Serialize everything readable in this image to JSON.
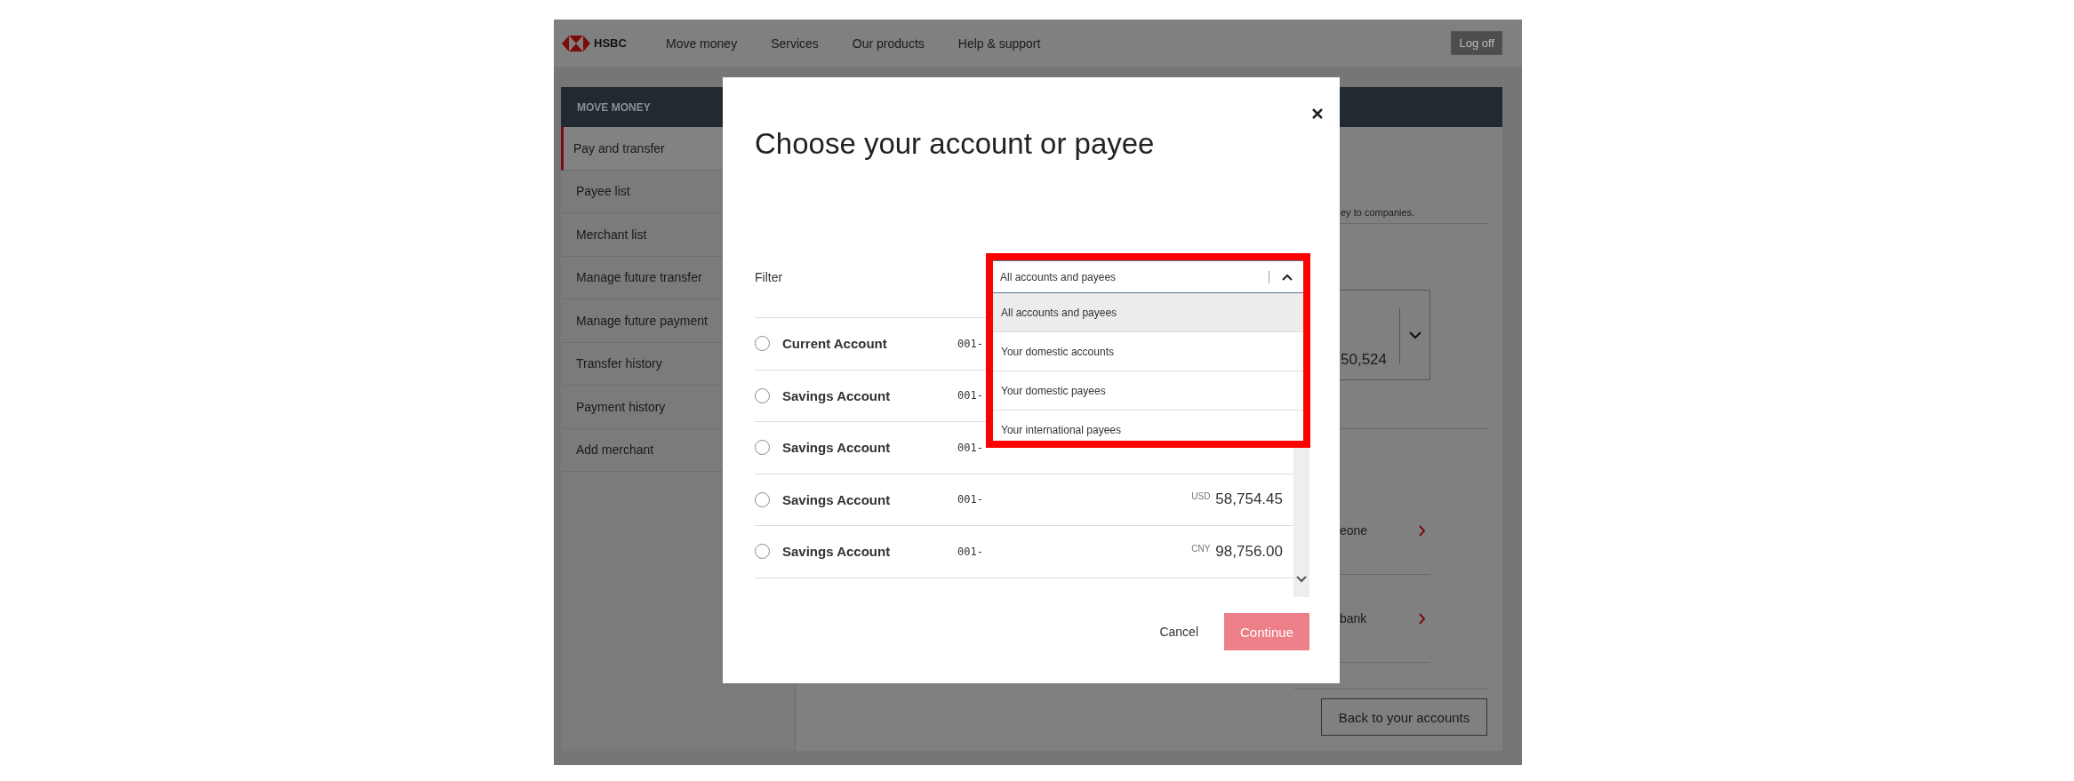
{
  "header": {
    "brand": "HSBC",
    "nav": [
      {
        "label": "Move money"
      },
      {
        "label": "Services"
      },
      {
        "label": "Our products"
      },
      {
        "label": "Help & support"
      }
    ],
    "logoff": "Log off"
  },
  "sidebar": {
    "title": "MOVE MONEY",
    "items": [
      {
        "label": "Pay and transfer",
        "selected": true
      },
      {
        "label": "Payee list",
        "selected": false
      },
      {
        "label": "Merchant list",
        "selected": false
      },
      {
        "label": "Manage future transfer",
        "selected": false
      },
      {
        "label": "Manage future payment",
        "selected": false
      },
      {
        "label": "Transfer history",
        "selected": false
      },
      {
        "label": "Payment history",
        "selected": false
      },
      {
        "label": "Add merchant",
        "selected": false
      }
    ]
  },
  "background": {
    "intro_fragment": "ey to companies.",
    "balance_fragment": "50,524",
    "links": [
      {
        "label": "eone"
      },
      {
        "label": "bank"
      }
    ],
    "back_button": "Back to your accounts"
  },
  "modal": {
    "title": "Choose your account or payee",
    "filter": {
      "label": "Filter",
      "value": "All accounts and payees",
      "expanded": true,
      "highlighted": true,
      "options": [
        {
          "label": "All accounts and payees",
          "selected": true
        },
        {
          "label": "Your domestic accounts",
          "selected": false
        },
        {
          "label": "Your domestic payees",
          "selected": false
        },
        {
          "label": "Your international payees",
          "selected": false
        }
      ]
    },
    "accounts": [
      {
        "name": "Current Account",
        "number": "001-",
        "selected": false
      },
      {
        "name": "Savings Account",
        "number": "001-",
        "selected": false
      },
      {
        "name": "Savings Account",
        "number": "001-",
        "selected": false
      },
      {
        "name": "Savings Account",
        "number": "001-",
        "currency": "USD",
        "amount": "58,754.45",
        "selected": false
      },
      {
        "name": "Savings Account",
        "number": "001-",
        "currency": "CNY",
        "amount": "98,756.00",
        "selected": false
      }
    ],
    "cancel": "Cancel",
    "continue": "Continue",
    "continue_disabled": true
  }
}
